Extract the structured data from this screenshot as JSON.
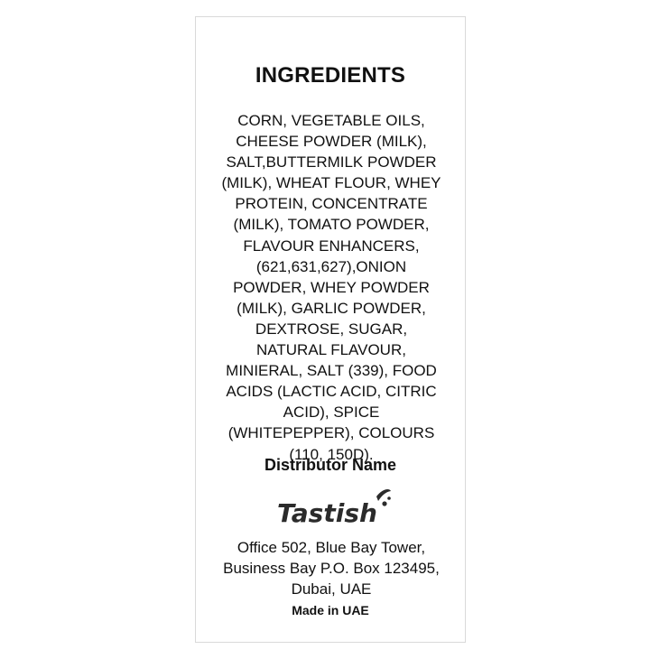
{
  "label": {
    "ingredients_title": "INGREDIENTS",
    "ingredients_text": "CORN, VEGETABLE OILS, CHEESE POWDER (MILK), SALT,BUTTERMILK POWDER (MILK), WHEAT FLOUR, WHEY PROTEIN, CONCENTRATE (MILK), TOMATO POWDER, FLAVOUR ENHANCERS, (621,631,627),ONION POWDER, WHEY POWDER (MILK), GARLIC POWDER, DEXTROSE, SUGAR, NATURAL FLAVOUR, MINIERAL, SALT (339), FOOD ACIDS (LACTIC ACID, CITRIC ACID), SPICE (WHITEPEPPER), COLOURS (110, 150D).",
    "distributor_heading": "Distributor Name",
    "logo_text": "Tastish",
    "address": "Office 502, Blue Bay Tower, Business Bay P.O. Box 123495, Dubai, UAE",
    "made_in": "Made in UAE"
  },
  "colors": {
    "text": "#111111",
    "logo": "#2b2b2b",
    "card_border": "#d9d9d9"
  }
}
